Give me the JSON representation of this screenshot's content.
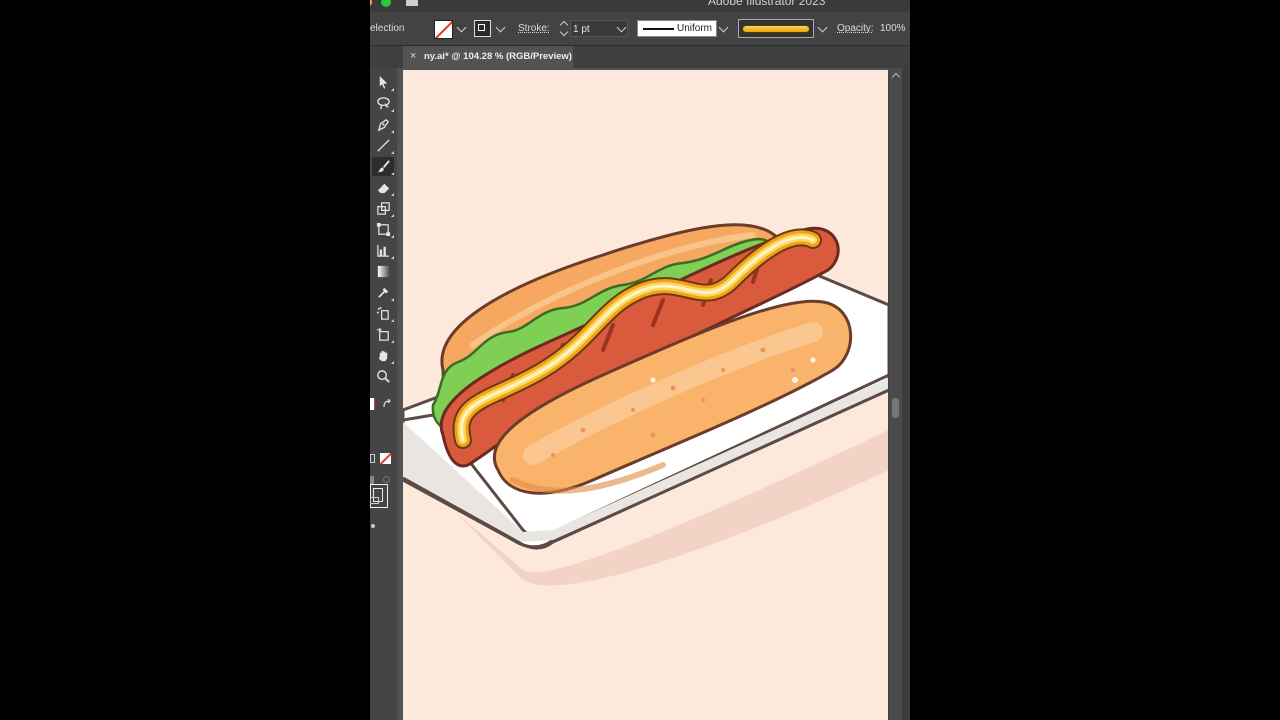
{
  "app": {
    "title": "Adobe Illustrator 2023"
  },
  "control_bar": {
    "mode_label": "election",
    "stroke_label": "Stroke:",
    "stroke_weight": "1 pt",
    "profile_label": "Uniform",
    "opacity_label": "Opacity:",
    "opacity_value": "100%"
  },
  "document_tab": {
    "close_glyph": "×",
    "title": "ny.ai* @ 104.28 % (RGB/Preview)"
  },
  "toolbar": {
    "tools": [
      "selection-tool-icon",
      "lasso-tool-icon",
      "pen-tool-icon",
      "line-tool-icon",
      "paintbrush-tool-icon",
      "eraser-tool-icon",
      "scale-tool-icon",
      "free-transform-tool-icon",
      "graph-tool-icon",
      "gradient-tool-icon",
      "eyedropper-tool-icon",
      "symbol-sprayer-tool-icon",
      "artboard-tool-icon",
      "hand-tool-icon",
      "zoom-tool-icon"
    ],
    "active_tool": "paintbrush-tool-icon"
  },
  "colors": {
    "artboard_bg": "#fde8dc",
    "brush_stroke": "#f5b92a",
    "stroke_none_red": "#e33322"
  }
}
